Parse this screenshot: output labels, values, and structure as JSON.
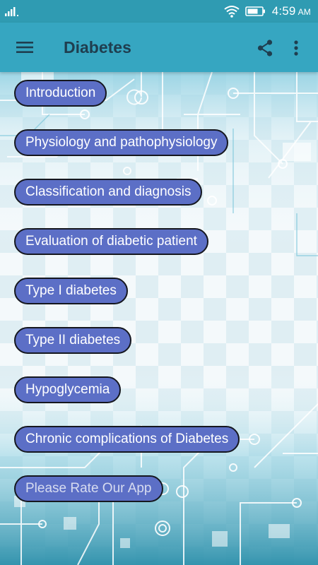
{
  "status_bar": {
    "time": "4:59",
    "ampm": "AM",
    "icons": [
      "signal-icon",
      "wifi-icon",
      "battery-icon"
    ]
  },
  "app_bar": {
    "title": "Diabetes",
    "icons": [
      "hamburger-menu-icon",
      "share-icon",
      "overflow-menu-icon"
    ]
  },
  "colors": {
    "status_bar": "#2f9bb2",
    "app_bar": "#36a6c1",
    "button_fill": "#5c6fc6",
    "button_border": "#15171f",
    "title_text": "#1f3e4f"
  },
  "menu": {
    "items": [
      {
        "label": "Introduction"
      },
      {
        "label": "Physiology and pathophysiology"
      },
      {
        "label": "Classification and diagnosis"
      },
      {
        "label": "Evaluation of diabetic patient"
      },
      {
        "label": "Type I diabetes"
      },
      {
        "label": "Type II diabetes"
      },
      {
        "label": "Hypoglycemia"
      },
      {
        "label": "Chronic complications of Diabetes"
      },
      {
        "label": "Please Rate Our App"
      }
    ]
  }
}
